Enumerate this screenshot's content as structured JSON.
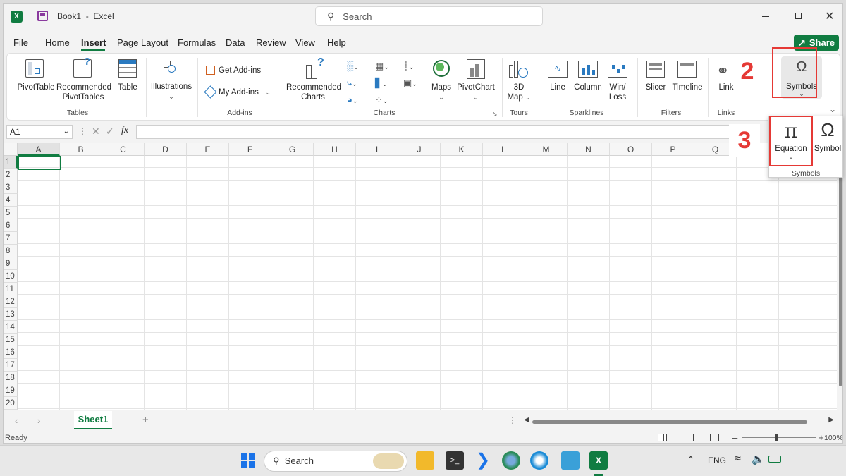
{
  "app": {
    "doc_name": "Book1",
    "separator": "-",
    "app_name": "Excel"
  },
  "search": {
    "placeholder": "Search"
  },
  "menu": [
    "File",
    "Home",
    "Insert",
    "Page Layout",
    "Formulas",
    "Data",
    "Review",
    "View",
    "Help"
  ],
  "share_label": "Share",
  "ribbon": {
    "pivottable": "PivotTable",
    "recommended_pivot_1": "Recommended",
    "recommended_pivot_2": "PivotTables",
    "table": "Table",
    "illustrations": "Illustrations",
    "get_addins": "Get Add-ins",
    "my_addins": "My Add-ins",
    "recommended_charts_1": "Recommended",
    "recommended_charts_2": "Charts",
    "maps": "Maps",
    "pivotchart": "PivotChart",
    "map3d_1": "3D",
    "map3d_2": "Map",
    "line": "Line",
    "column": "Column",
    "winloss_1": "Win/",
    "winloss_2": "Loss",
    "slicer": "Slicer",
    "timeline": "Timeline",
    "link": "Link",
    "symbols": "Symbols",
    "groups": {
      "tables": "Tables",
      "addins": "Add-ins",
      "charts": "Charts",
      "tours": "Tours",
      "sparklines": "Sparklines",
      "filters": "Filters",
      "links": "Links"
    }
  },
  "formula_bar": {
    "name_box": "A1",
    "fx": "fx"
  },
  "columns": [
    "A",
    "B",
    "C",
    "D",
    "E",
    "F",
    "G",
    "H",
    "I",
    "J",
    "K",
    "L",
    "M",
    "N",
    "O",
    "P",
    "Q"
  ],
  "rows": [
    "1",
    "2",
    "3",
    "4",
    "5",
    "6",
    "7",
    "8",
    "9",
    "10",
    "11",
    "12",
    "13",
    "14",
    "15",
    "16",
    "17",
    "18",
    "19",
    "20"
  ],
  "sheet_tab": "Sheet1",
  "status": {
    "ready": "Ready",
    "zoom": "100%"
  },
  "popup": {
    "equation": "Equation",
    "symbol": "Symbol",
    "group": "Symbols"
  },
  "annotations": {
    "step2": "2",
    "step3": "3"
  },
  "taskbar": {
    "search": "Search",
    "lang": "ENG"
  },
  "colors": {
    "excel_green": "#107c41",
    "annotation_red": "#e53935"
  }
}
